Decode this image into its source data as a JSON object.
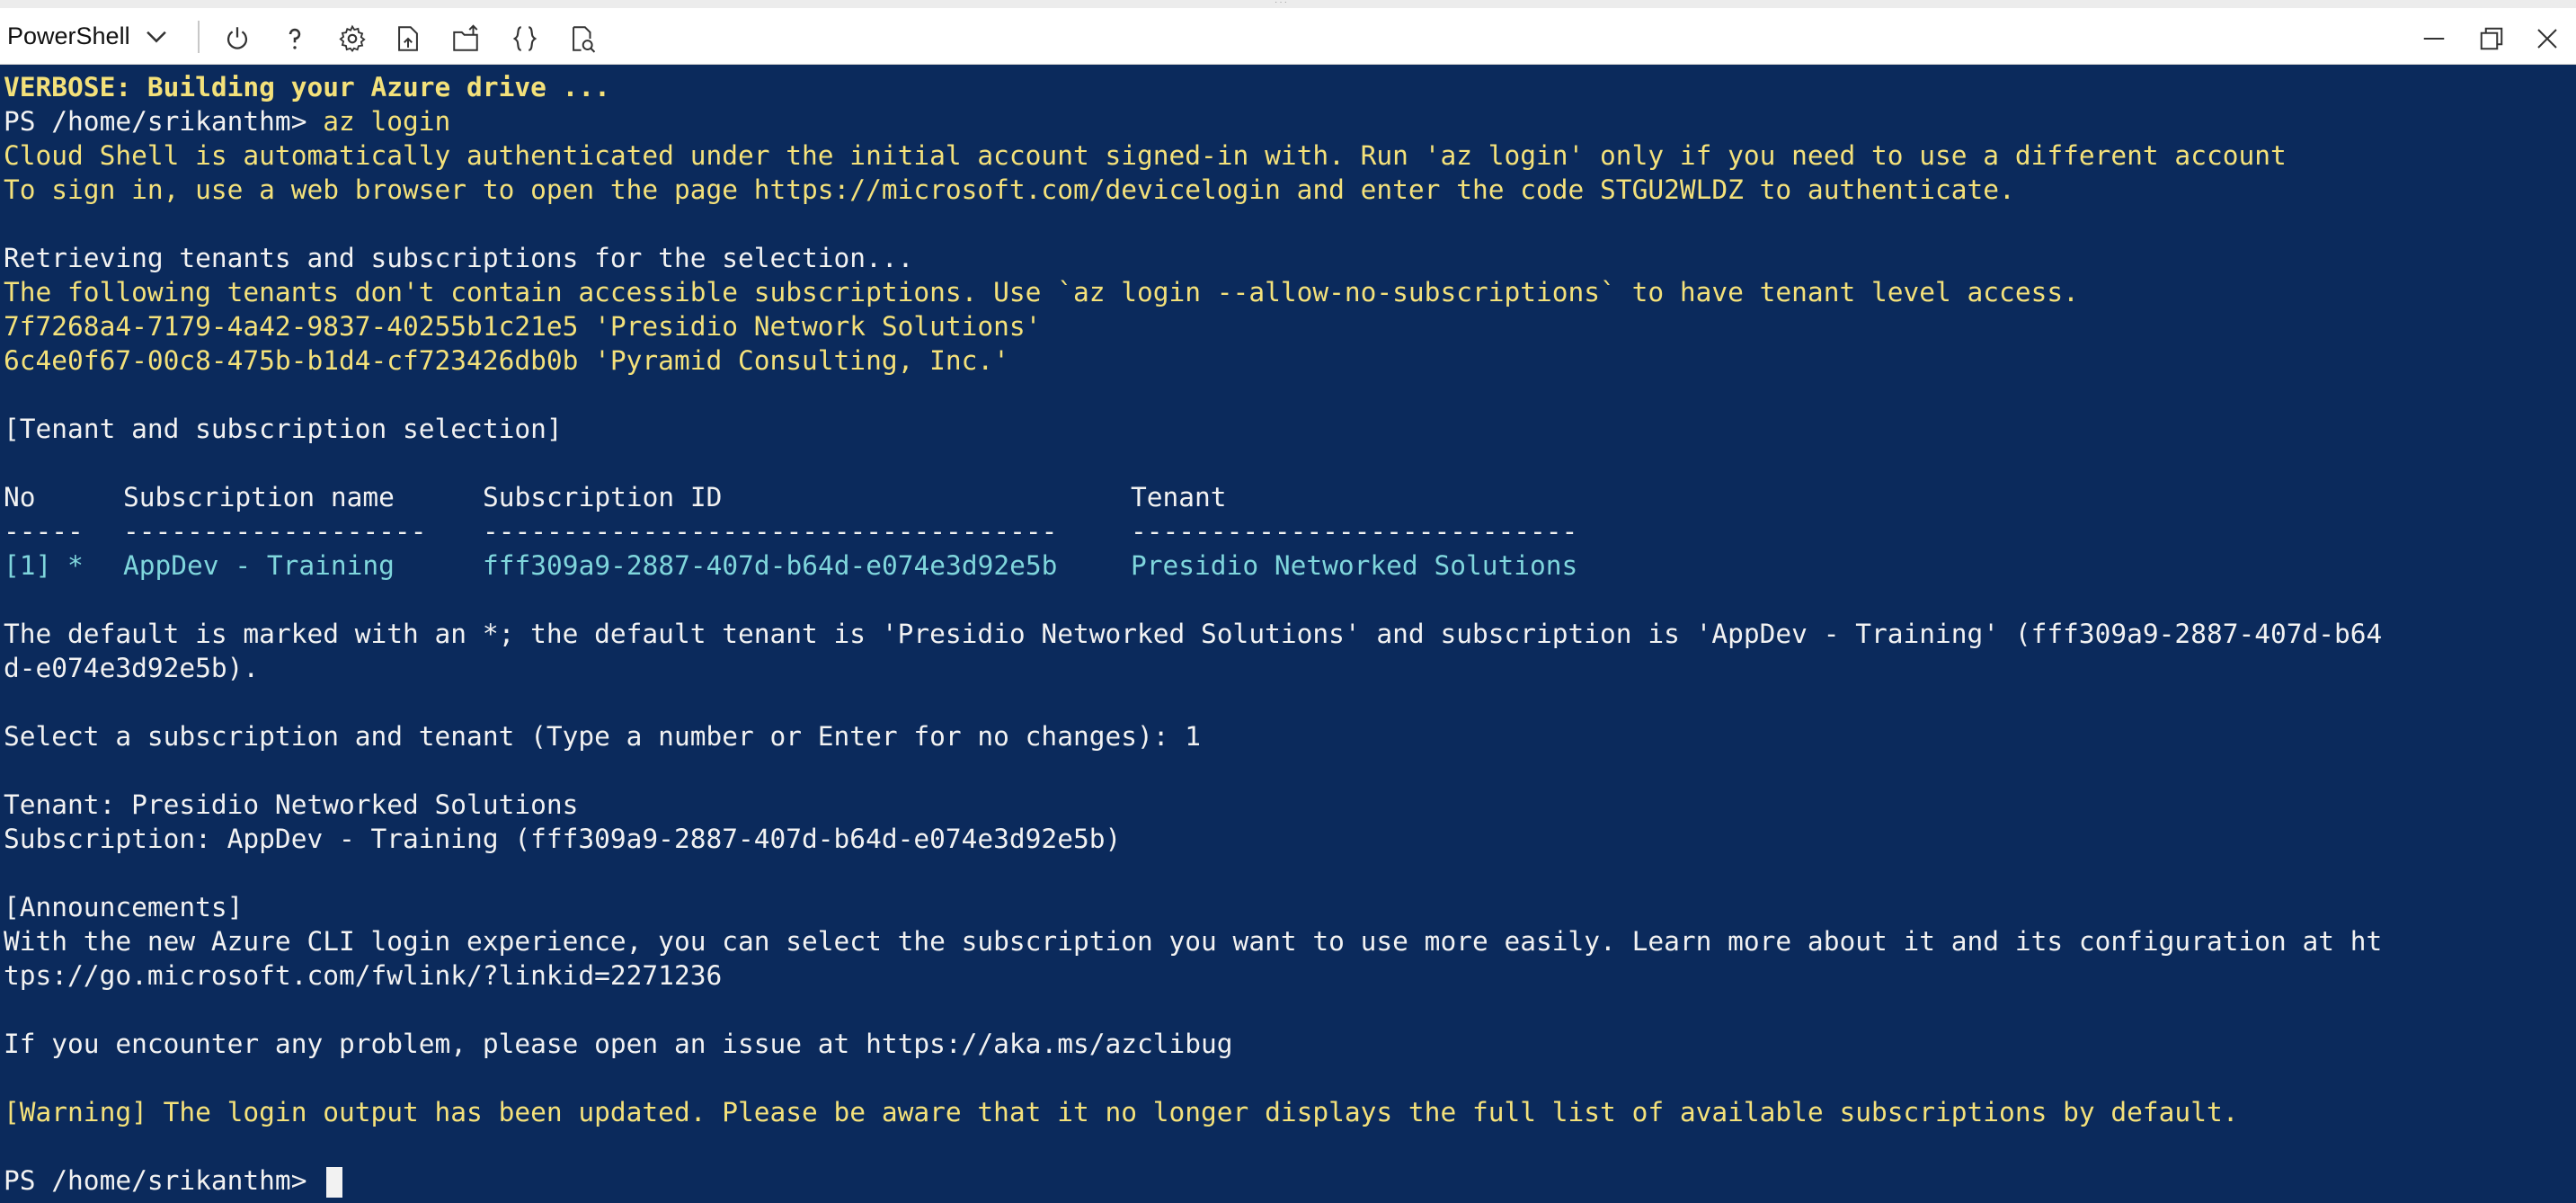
{
  "toolbar": {
    "shell_label": "PowerShell",
    "icons": [
      "chevron-down-icon",
      "power-icon",
      "help-icon",
      "gear-icon",
      "upload-download-icon",
      "open-file-share-icon",
      "braces-editor-icon",
      "web-preview-icon",
      "minimize-icon",
      "restore-icon",
      "close-icon"
    ]
  },
  "terminal": {
    "colors": {
      "background": "#0b2a5c",
      "text": "#f2f2f2",
      "warning": "#f4e17a",
      "table": "#7fd6dc"
    },
    "lines": {
      "l1": "VERBOSE: Building your Azure drive ...",
      "l2_prompt": "PS /home/srikanthm> ",
      "l2_cmd": "az login",
      "l3": "Cloud Shell is automatically authenticated under the initial account signed-in with. Run 'az login' only if you need to use a different account",
      "l4": "To sign in, use a web browser to open the page https://microsoft.com/devicelogin and enter the code STGU2WLDZ to authenticate.",
      "l6": "Retrieving tenants and subscriptions for the selection...",
      "l7": "The following tenants don't contain accessible subscriptions. Use `az login --allow-no-subscriptions` to have tenant level access.",
      "l8": "7f7268a4-7179-4a42-9837-40255b1c21e5 'Presidio Network Solutions'",
      "l9": "6c4e0f67-00c8-475b-b1d4-cf723426db0b 'Pyramid Consulting, Inc.'",
      "l11": "[Tenant and subscription selection]",
      "l18": "The default is marked with an *; the default tenant is 'Presidio Networked Solutions' and subscription is 'AppDev - Training' (fff309a9-2887-407d-b64",
      "l19": "d-e074e3d92e5b).",
      "l21": "Select a subscription and tenant (Type a number or Enter for no changes): 1",
      "l23": "Tenant: Presidio Networked Solutions",
      "l24": "Subscription: AppDev - Training (fff309a9-2887-407d-b64d-e074e3d92e5b)",
      "l26": "[Announcements]",
      "l27": "With the new Azure CLI login experience, you can select the subscription you want to use more easily. Learn more about it and its configuration at ht",
      "l28": "tps://go.microsoft.com/fwlink/?linkid=2271236",
      "l30": "If you encounter any problem, please open an issue at https://aka.ms/azclibug",
      "l32": "[Warning] The login output has been updated. Please be aware that it no longer displays the full list of available subscriptions by default.",
      "l34_prompt": "PS /home/srikanthm> "
    },
    "table": {
      "headers": [
        "No",
        "Subscription name",
        "Subscription ID",
        "Tenant"
      ],
      "dividers": [
        "-----",
        "-------------------",
        "------------------------------------",
        "----------------------------"
      ],
      "rows": [
        [
          "[1] *",
          "AppDev - Training",
          "fff309a9-2887-407d-b64d-e074e3d92e5b",
          "Presidio Networked Solutions"
        ]
      ]
    }
  }
}
